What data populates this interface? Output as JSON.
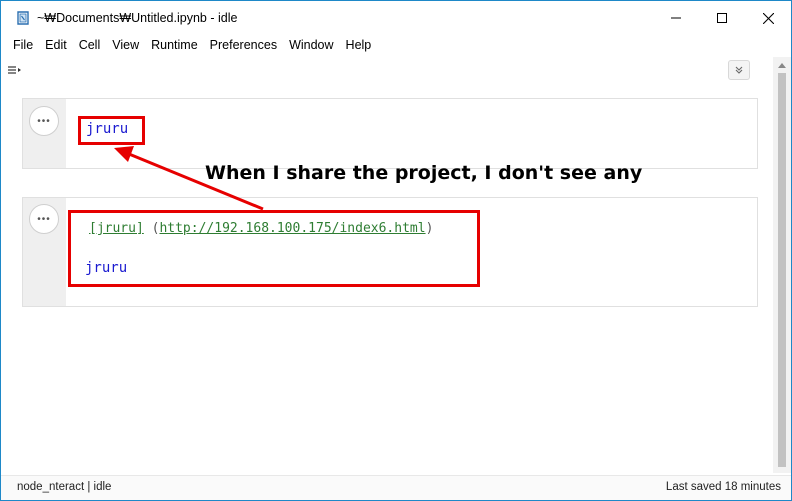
{
  "window": {
    "title": "~₩Documents₩Untitled.ipynb - idle",
    "accent_color": "#1e88c8"
  },
  "menubar": {
    "items": [
      {
        "label": "File"
      },
      {
        "label": "Edit"
      },
      {
        "label": "Cell"
      },
      {
        "label": "View"
      },
      {
        "label": "Runtime"
      },
      {
        "label": "Preferences"
      },
      {
        "label": "Window"
      },
      {
        "label": "Help"
      }
    ]
  },
  "toolbar": {
    "toc_icon": "toc-toggle-icon",
    "collapse_icon": "chevron-double-down-icon"
  },
  "cells": [
    {
      "menu_glyph": "•••",
      "source": "jruru"
    },
    {
      "menu_glyph": "•••",
      "link_text": "[jruru]",
      "link_url_prefix": " (",
      "link_url": "http://192.168.100.175/index6.html",
      "link_url_suffix": ")",
      "output": "jruru"
    }
  ],
  "annotation": {
    "text": "When I share the project, I don't see any",
    "highlight_color": "#e60000"
  },
  "statusbar": {
    "left": "node_nteract | idle",
    "right": "Last saved 18 minutes"
  }
}
